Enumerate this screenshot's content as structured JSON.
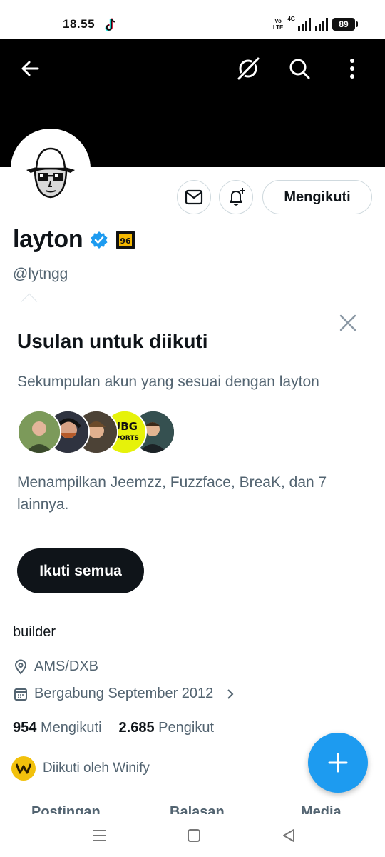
{
  "status_bar": {
    "time": "18.55",
    "network_top": "Vo",
    "network_bottom": "LTE",
    "network_type": "4G",
    "battery": "89"
  },
  "header": {
    "back_icon": "arrow-left-icon",
    "grok_icon": "grok-icon",
    "search_icon": "search-icon",
    "more_icon": "more-vertical-icon",
    "banner_color": "#000000"
  },
  "profile": {
    "display_name": "layton",
    "handle": "@lytngg",
    "verified_color": "#1d9bf0",
    "follow_button": "Mengikuti",
    "bio": "builder",
    "location": "AMS/DXB",
    "joined": "Bergabung September 2012",
    "following_count": "954",
    "following_label": "Mengikuti",
    "followers_count": "2.685",
    "followers_label": "Pengikut",
    "followed_by": "Diikuti oleh Winify"
  },
  "suggestions": {
    "title": "Usulan untuk diikuti",
    "subtitle": "Sekumpulan akun yang sesuai dengan layton",
    "description": "Menampilkan Jeemzz, Fuzzface, BreaK, dan 7 lainnya.",
    "follow_all": "Ikuti semua",
    "badge_text": "UBG",
    "badge_text_2": "SPORTS"
  },
  "tabs": [
    "Postingan",
    "Balasan",
    "Media"
  ],
  "accent_color": "#1d9bf0"
}
